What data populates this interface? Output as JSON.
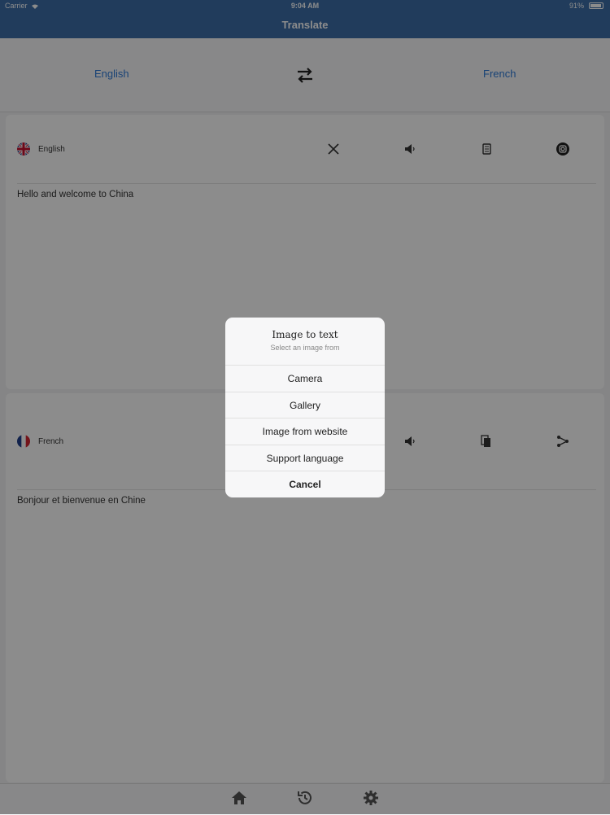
{
  "status": {
    "carrier": "Carrier",
    "time": "9:04 AM",
    "battery": "91%"
  },
  "nav": {
    "title": "Translate"
  },
  "language_bar": {
    "source": "English",
    "target": "French",
    "swap_icon": "swap-arrows-icon"
  },
  "source_card": {
    "language": "English",
    "flag": "uk-flag-icon",
    "text": "Hello and welcome to China",
    "tools": [
      "clear-icon",
      "speaker-icon",
      "paste-icon",
      "camera-icon"
    ]
  },
  "target_card": {
    "language": "French",
    "flag": "france-flag-icon",
    "text": "Bonjour et bienvenue en Chine",
    "tools": [
      "speaker-icon",
      "copy-icon",
      "share-icon"
    ]
  },
  "tabbar": {
    "items": [
      "home-icon",
      "history-icon",
      "settings-icon"
    ]
  },
  "action_sheet": {
    "title": "Image to text",
    "subtitle": "Select an image from",
    "options": [
      "Camera",
      "Gallery",
      "Image from website",
      "Support language"
    ],
    "cancel": "Cancel"
  },
  "colors": {
    "accent": "#2f7bd8",
    "navbar": "#3c6ea8"
  }
}
